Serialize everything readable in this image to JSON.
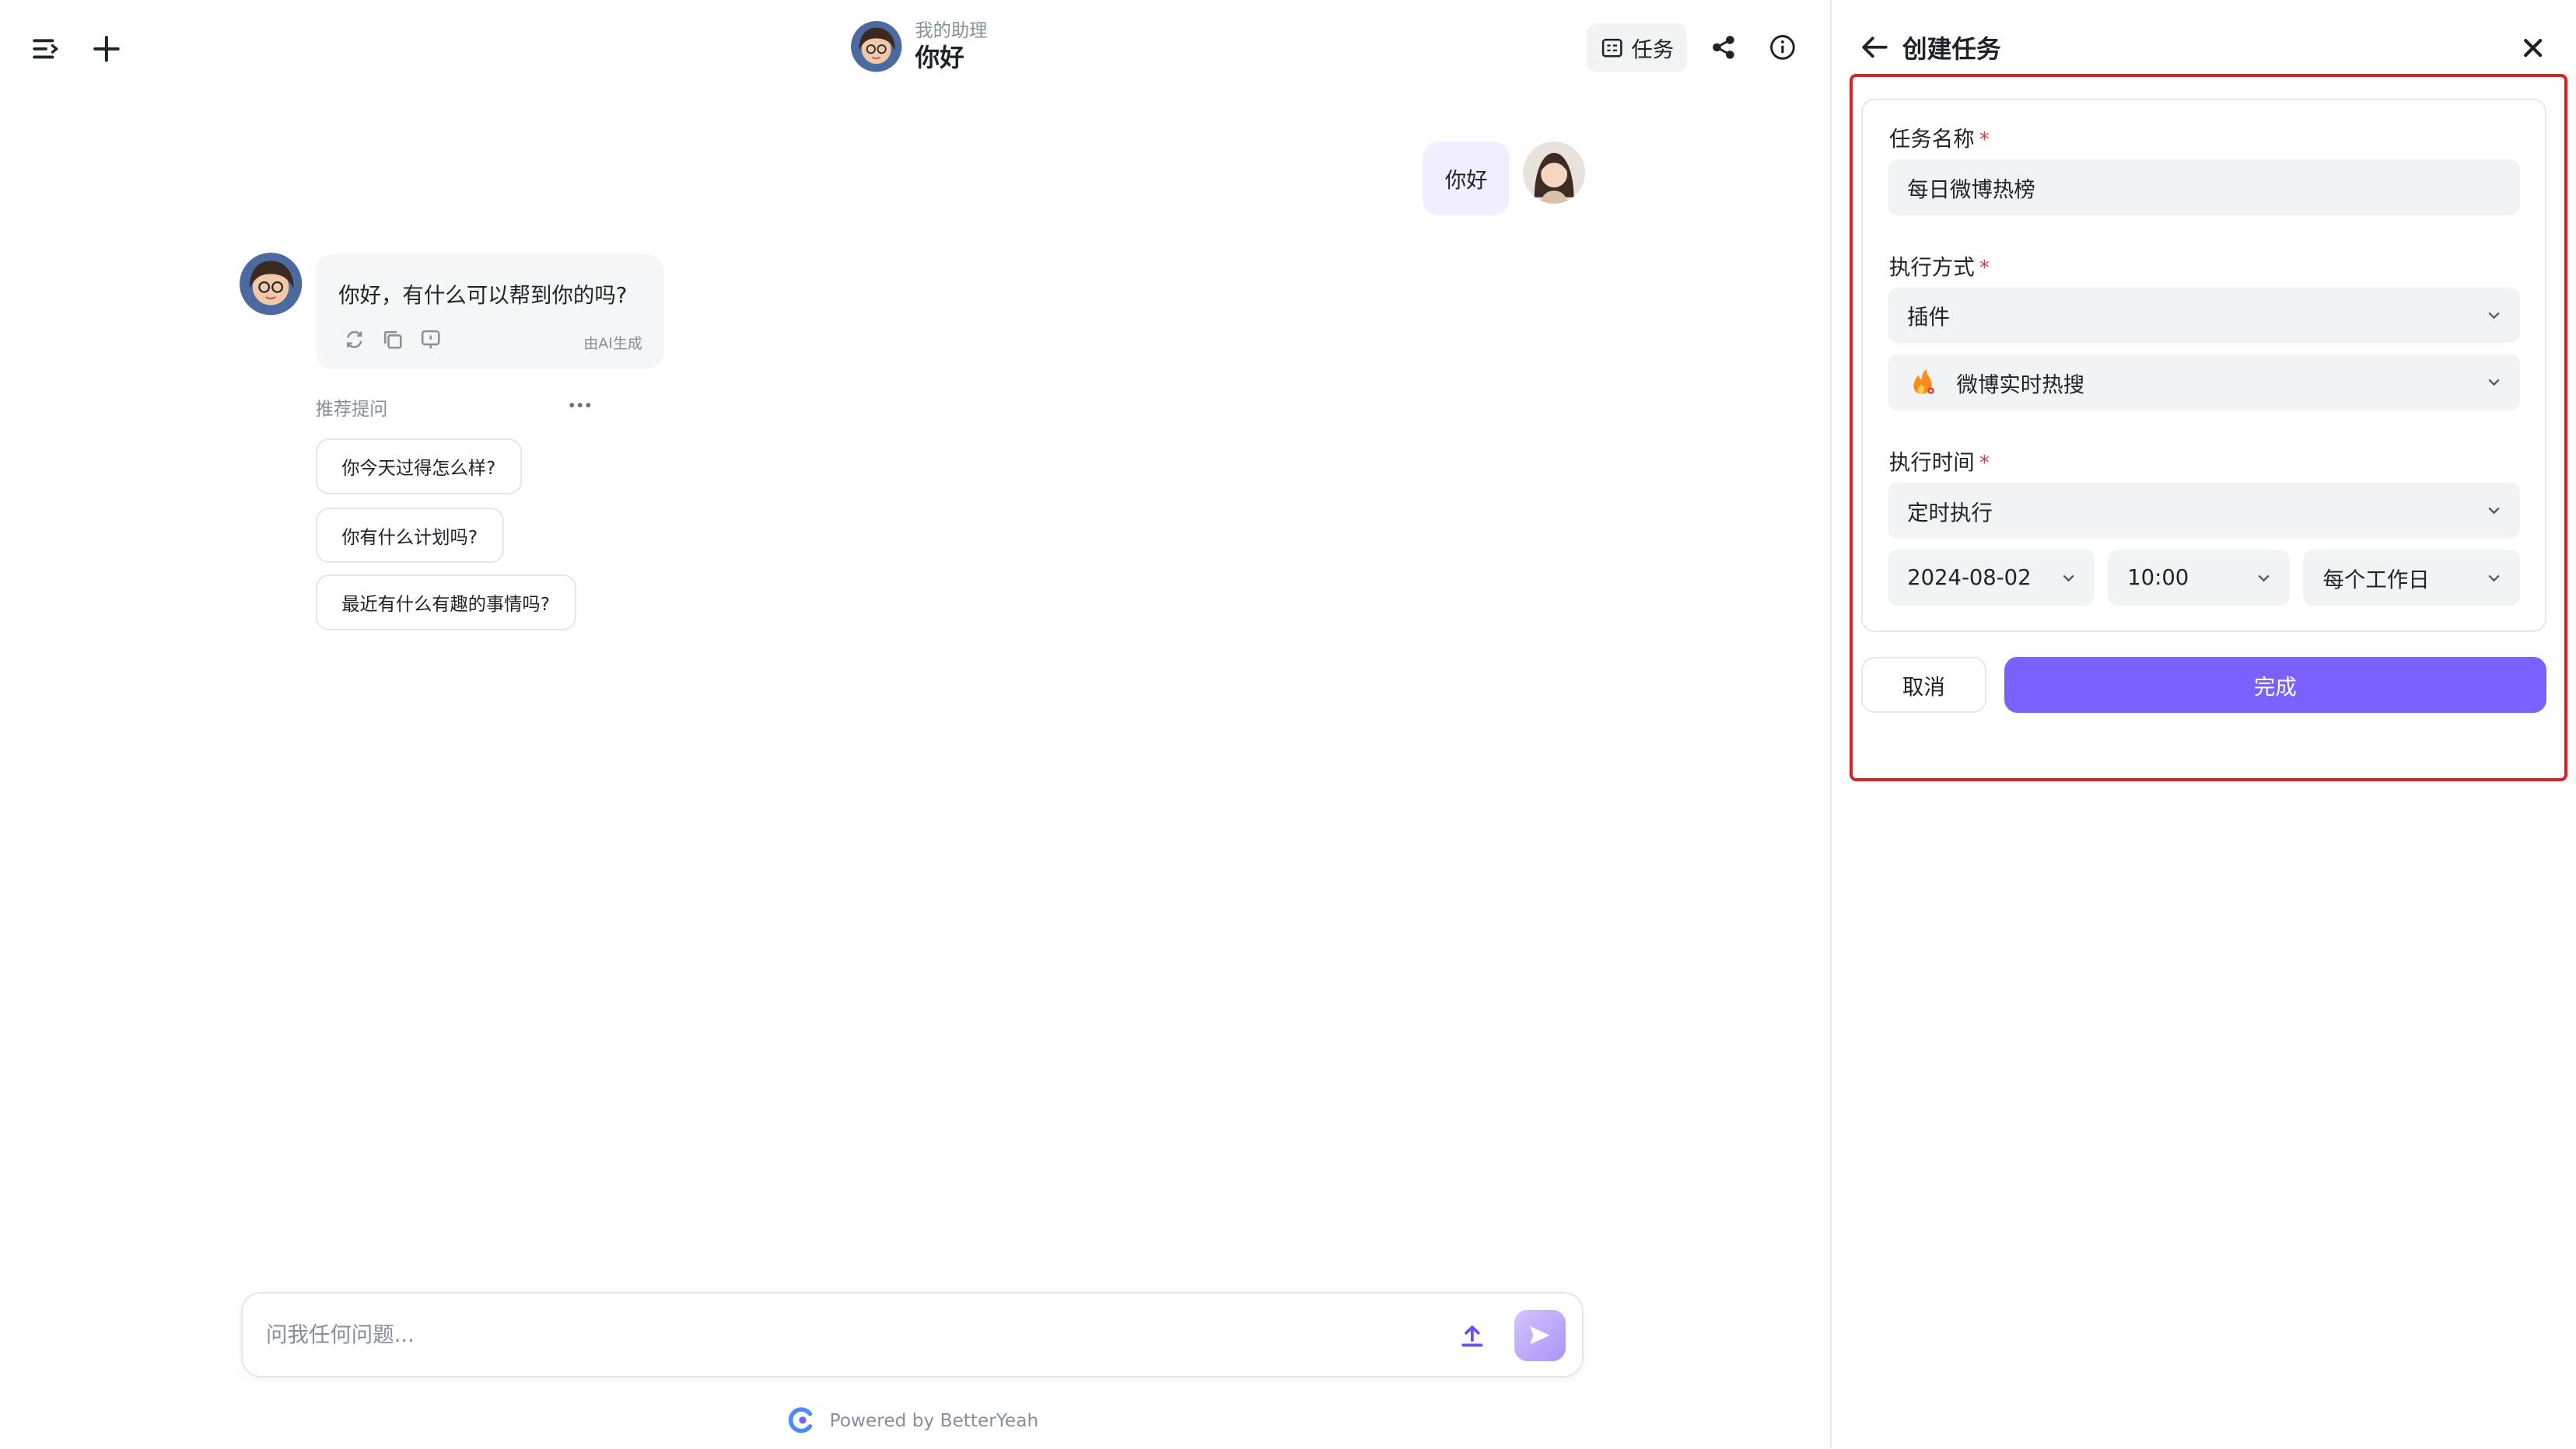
{
  "header": {
    "assistant_subtitle": "我的助理",
    "assistant_name": "你好",
    "task_button_label": "任务"
  },
  "chat": {
    "user_message": "你好",
    "bot_message": "你好，有什么可以帮到你的吗?",
    "ai_generated_tag": "由AI生成",
    "suggestions_label": "推荐提问",
    "suggestions": [
      "你今天过得怎么样?",
      "你有什么计划吗?",
      "最近有什么有趣的事情吗?"
    ]
  },
  "composer": {
    "placeholder": "问我任何问题..."
  },
  "footer": {
    "powered_by": "Powered by BetterYeah"
  },
  "panel": {
    "title": "创建任务",
    "required_mark": "*",
    "task_name_label": "任务名称",
    "task_name_value": "每日微博热榜",
    "exec_method_label": "执行方式",
    "exec_method_value": "插件",
    "plugin_value": "微博实时热搜",
    "exec_time_label": "执行时间",
    "schedule_value": "定时执行",
    "date_value": "2024-08-02",
    "time_value": "10:00",
    "repeat_value": "每个工作日",
    "cancel_label": "取消",
    "done_label": "完成"
  },
  "colors": {
    "accent": "#7b61ff",
    "required": "#e8363d",
    "highlight_frame": "#e02020"
  }
}
